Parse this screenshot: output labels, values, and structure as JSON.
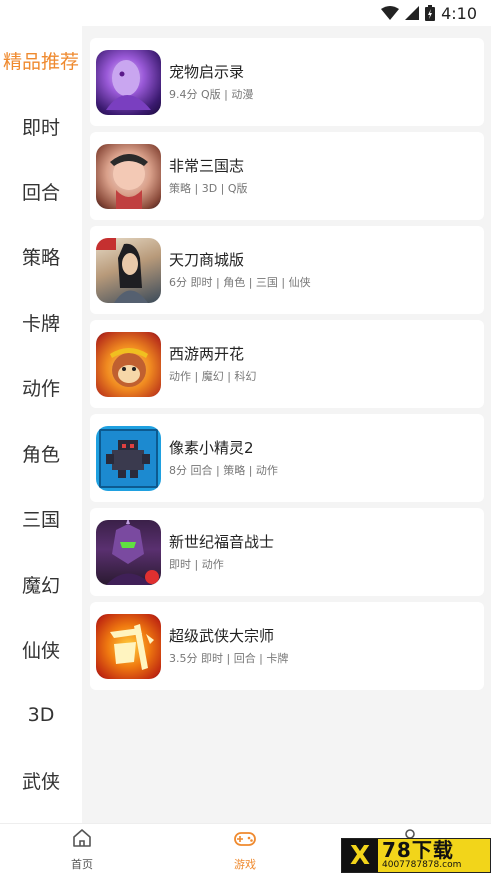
{
  "status_bar": {
    "time": "4:10"
  },
  "sidebar": {
    "items": [
      {
        "label": "精品推荐"
      },
      {
        "label": "即时"
      },
      {
        "label": "回合"
      },
      {
        "label": "策略"
      },
      {
        "label": "卡牌"
      },
      {
        "label": "动作"
      },
      {
        "label": "角色"
      },
      {
        "label": "三国"
      },
      {
        "label": "魔幻"
      },
      {
        "label": "仙侠"
      },
      {
        "label": "3D"
      },
      {
        "label": "武侠"
      }
    ],
    "active_index": 0
  },
  "games": [
    {
      "name": "宠物启示录",
      "tags": "9.4分 Q版 | 动漫",
      "icon": "pet-game-icon"
    },
    {
      "name": "非常三国志",
      "tags": "策略 | 3D | Q版",
      "icon": "three-kingdoms-icon"
    },
    {
      "name": "天刀商城版",
      "tags": "6分 即时 | 角色 | 三国 | 仙侠",
      "icon": "swordsman-icon"
    },
    {
      "name": "西游两开花",
      "tags": "动作 | 魔幻 | 科幻",
      "icon": "monkey-king-icon"
    },
    {
      "name": "像素小精灵2",
      "tags": "8分 回合 | 策略 | 动作",
      "icon": "pixel-dragon-icon"
    },
    {
      "name": "新世纪福音战士",
      "tags": "即时 | 动作",
      "icon": "mecha-icon"
    },
    {
      "name": "超级武侠大宗师",
      "tags": "3.5分 即时 | 回合 | 卡牌",
      "icon": "martial-arts-icon"
    }
  ],
  "tabbar": {
    "home_label": "首页",
    "games_label": "游戏"
  },
  "watermark": {
    "main": "78下载",
    "sub": "4007787878.com"
  },
  "colors": {
    "accent": "#ef8a2f",
    "content_bg": "#f4f4f4"
  }
}
